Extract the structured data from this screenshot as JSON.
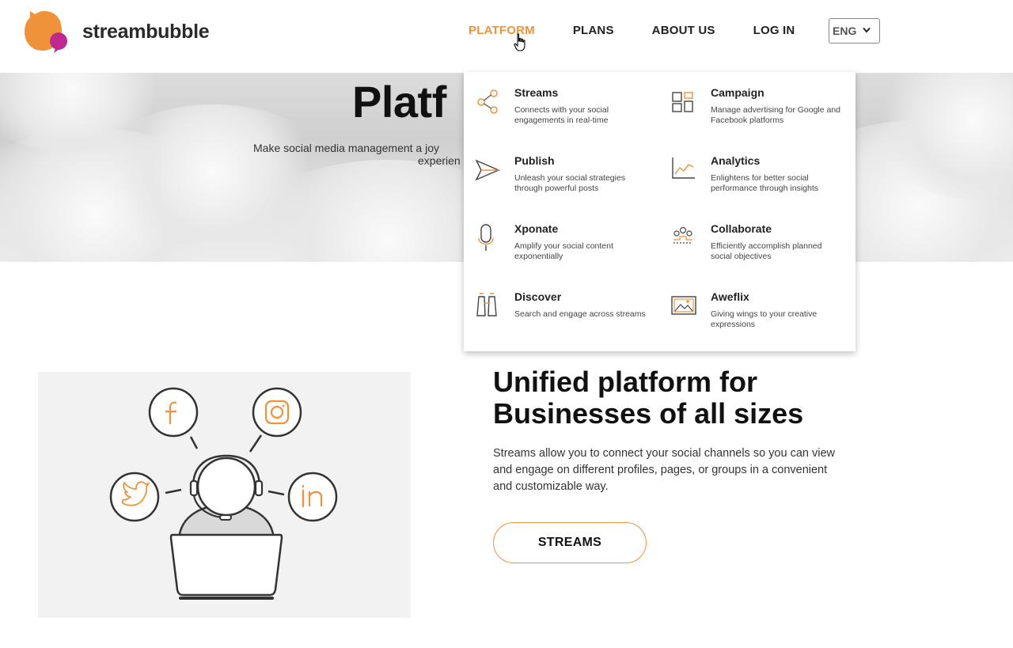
{
  "brand": {
    "name": "streambubble",
    "primary_color": "#f0923a",
    "secondary_color": "#c0298f"
  },
  "nav": {
    "items": [
      {
        "label": "PLATFORM",
        "active": true
      },
      {
        "label": "PLANS"
      },
      {
        "label": "ABOUT US"
      },
      {
        "label": "LOG IN"
      }
    ],
    "language": "ENG"
  },
  "hero": {
    "title": "Platf",
    "subtitle_line1": "Make social media management a joy",
    "subtitle_line2": "experien"
  },
  "platform_menu": {
    "items": [
      {
        "title": "Streams",
        "description": "Connects with your social engagements in real-time",
        "icon": "share-icon"
      },
      {
        "title": "Campaign",
        "description": "Manage advertising for Google and Facebook platforms",
        "icon": "layout-grid-icon"
      },
      {
        "title": "Publish",
        "description": "Unleash your social strategies through powerful posts",
        "icon": "paper-plane-icon"
      },
      {
        "title": "Analytics",
        "description": "Enlightens for better social performance through insights",
        "icon": "line-chart-icon"
      },
      {
        "title": "Xponate",
        "description": "Amplify your social content exponentially",
        "icon": "microphone-icon"
      },
      {
        "title": "Collaborate",
        "description": "Efficiently accomplish planned social objectives",
        "icon": "team-icon"
      },
      {
        "title": "Discover",
        "description": "Search and engage across streams",
        "icon": "binoculars-icon"
      },
      {
        "title": "Aweflix",
        "description": "Giving wings to your creative expressions",
        "icon": "image-frame-icon"
      }
    ]
  },
  "feature": {
    "title_line1": "Unified platform for",
    "title_line2": "Businesses of all sizes",
    "description": "Streams allow you to connect your social channels so you can view and engage on different profiles, pages, or groups in a convenient and customizable way.",
    "button_label": "STREAMS"
  },
  "illustration": {
    "icons": [
      "facebook-icon",
      "instagram-icon",
      "twitter-icon",
      "linkedin-icon"
    ]
  }
}
